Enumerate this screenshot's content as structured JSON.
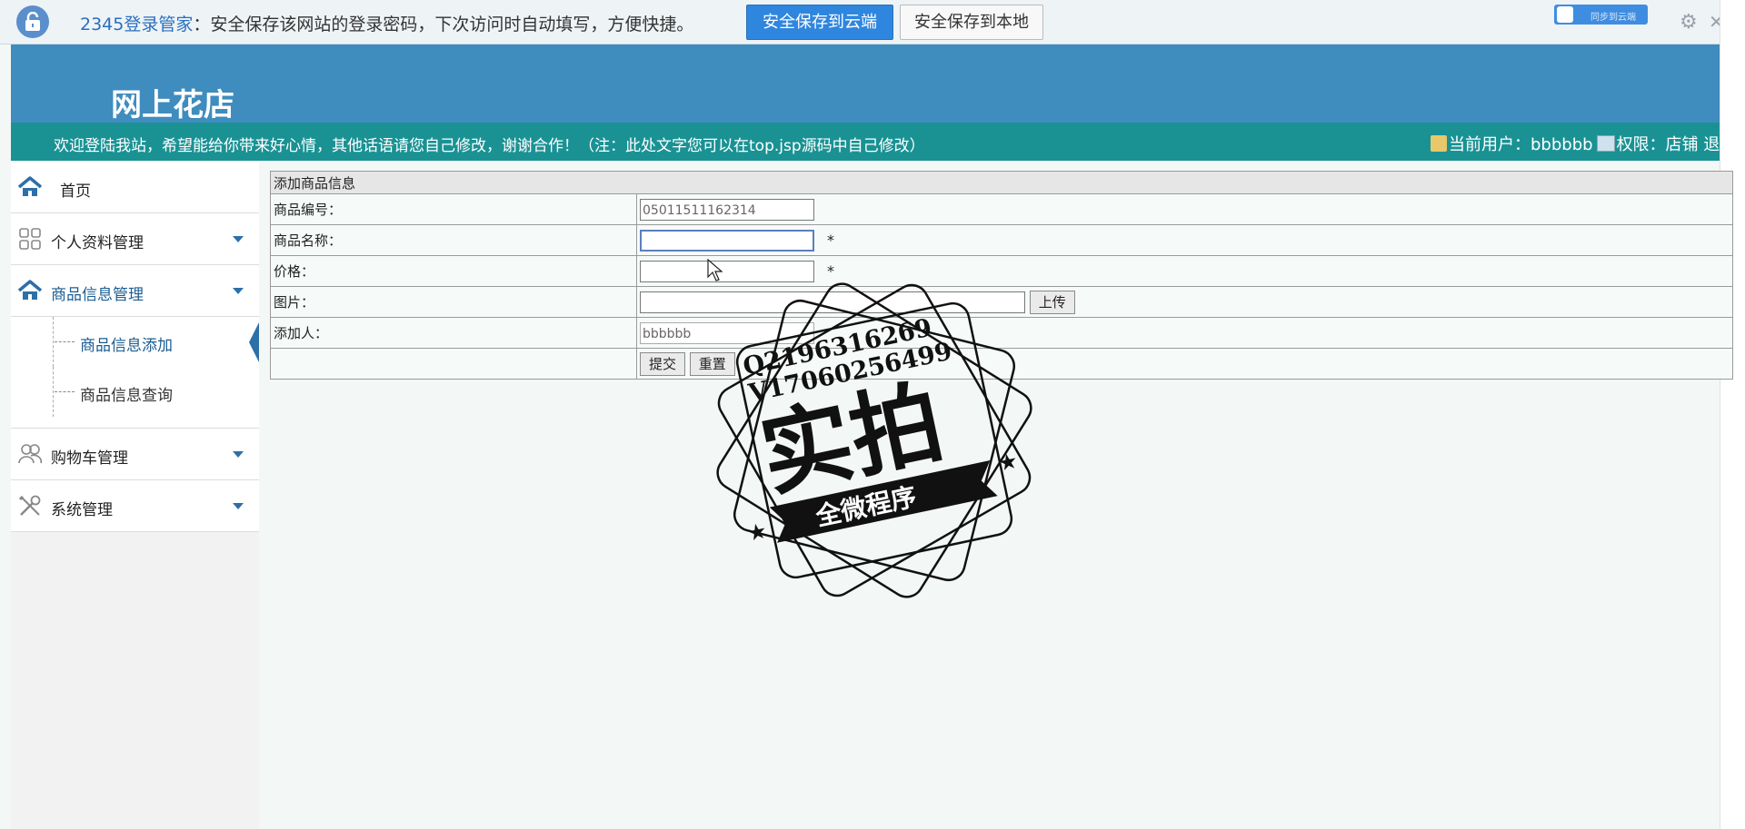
{
  "password_manager": {
    "brand": "2345登录管家",
    "message": "：安全保存该网站的登录密码，下次访问时自动填写，方便快捷。",
    "save_cloud_label": "安全保存到云端",
    "save_local_label": "安全保存到本地",
    "cloud_badge_label": "同步到云端"
  },
  "header": {
    "site_title": "网上花店",
    "welcome": "欢迎登陆我站，希望能给你带来好心情，其他话语请您自己修改，谢谢合作！（注：此处文字您可以在top.jsp源码中自己修改）",
    "current_user_label": "当前用户：bbbbbb",
    "role_label": "权限：店铺",
    "logout_label": "退出"
  },
  "sidebar": {
    "home": "首页",
    "items": [
      {
        "label": "个人资料管理",
        "icon": "grid-icon"
      },
      {
        "label": "商品信息管理",
        "icon": "home-icon"
      },
      {
        "label": "购物车管理",
        "icon": "users-icon"
      },
      {
        "label": "系统管理",
        "icon": "tools-icon"
      }
    ],
    "goods_sub": [
      "商品信息添加",
      "商品信息查询"
    ]
  },
  "form": {
    "caption": "添加商品信息",
    "fields": [
      {
        "label": "商品编号：",
        "value": "05011511162314"
      },
      {
        "label": "商品名称：",
        "value": "",
        "required": "*"
      },
      {
        "label": "价格：",
        "value": "",
        "required": "*"
      },
      {
        "label": "图片：",
        "value": "",
        "upload": "上传"
      },
      {
        "label": "添加人：",
        "value": "bbbbbb"
      }
    ],
    "submit_label": "提交",
    "reset_label": "重置"
  },
  "watermark": {
    "qq": "Q2196316269",
    "v": "V17060256499",
    "main": "实拍",
    "ribbon": "全微程序"
  }
}
